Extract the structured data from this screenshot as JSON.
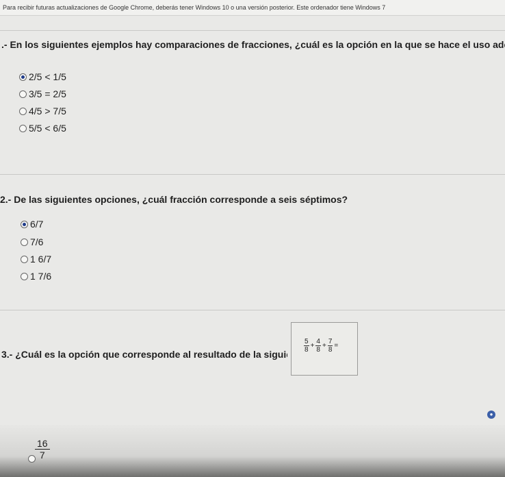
{
  "banner": {
    "text": "Para recibir futuras actualizaciones de Google Chrome, deberás tener Windows 10 o una versión posterior. Este ordenador tiene Windows 7"
  },
  "q1": {
    "prefix": ".-",
    "text": "En los siguientes ejemplos hay comparaciones de fracciones, ¿cuál es la opción en la que se hace el uso adecuado de los signos?",
    "options": [
      "2/5 < 1/5",
      "3/5 = 2/5",
      "4/5 > 7/5",
      "5/5 < 6/5"
    ],
    "selected": 0
  },
  "q2": {
    "prefix": "2.-",
    "text": "De las siguientes opciones, ¿cuál fracción corresponde a seis séptimos?",
    "options": [
      "6/7",
      "7/6",
      "1 6/7",
      "1 7/6"
    ],
    "selected": 0
  },
  "q3": {
    "prefix": "3.-",
    "text": "¿Cuál es la opción que corresponde al resultado de la siguiente suma de fracciones?",
    "expression": {
      "f1": {
        "num": "5",
        "den": "8"
      },
      "f2": {
        "num": "4",
        "den": "8"
      },
      "f3": {
        "num": "7",
        "den": "8"
      },
      "plus": "+",
      "equals": "="
    },
    "option1": {
      "num": "16",
      "den": "7"
    }
  },
  "colors": {
    "accent": "#1f3b8a"
  }
}
